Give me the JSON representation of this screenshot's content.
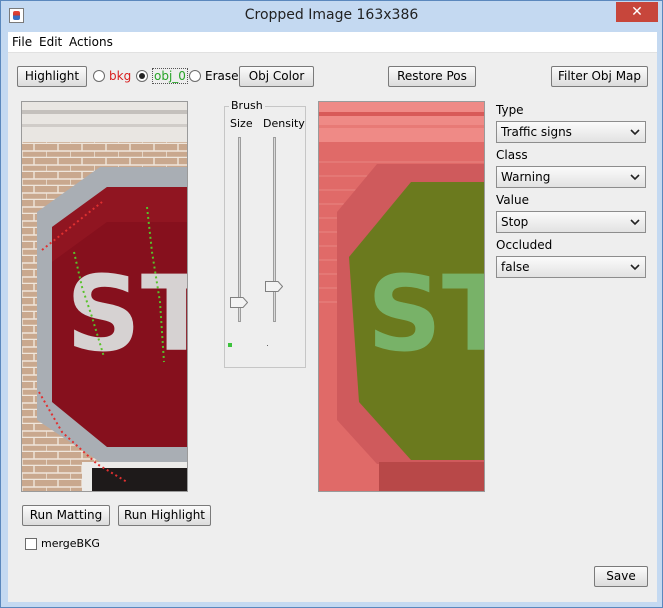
{
  "window": {
    "title": "Cropped Image  163x386",
    "close_glyph": "✕"
  },
  "menu": {
    "items": [
      "File",
      "Edit",
      "Actions"
    ]
  },
  "toolbar": {
    "highlight": "Highlight",
    "radio_bkg": "bkg",
    "radio_obj": "obj_0",
    "radio_erase": "Erase",
    "obj_color": "Obj Color",
    "restore_pos": "Restore Pos",
    "filter_obj_map": "Filter Obj Map",
    "selected_radio": "obj_0"
  },
  "brush": {
    "title": "Brush",
    "size_label": "Size",
    "density_label": "Density"
  },
  "left_image": {
    "text": "ST",
    "description_icon": "stop-sign-photo"
  },
  "right_image": {
    "text": "ST",
    "description_icon": "stop-sign-overlay"
  },
  "fields": {
    "type_label": "Type",
    "type_value": "Traffic signs",
    "class_label": "Class",
    "class_value": "Warning",
    "value_label": "Value",
    "value_value": "Stop",
    "occluded_label": "Occluded",
    "occluded_value": "false"
  },
  "bottom": {
    "run_matting": "Run Matting",
    "run_highlight": "Run Highlight",
    "merge_bkg": "mergeBKG",
    "save": "Save"
  },
  "colors": {
    "bkg_label": "#d81e1e",
    "obj_label": "#27a327",
    "overlay_red": "#e06060",
    "overlay_obj": "#6b7d1f"
  }
}
